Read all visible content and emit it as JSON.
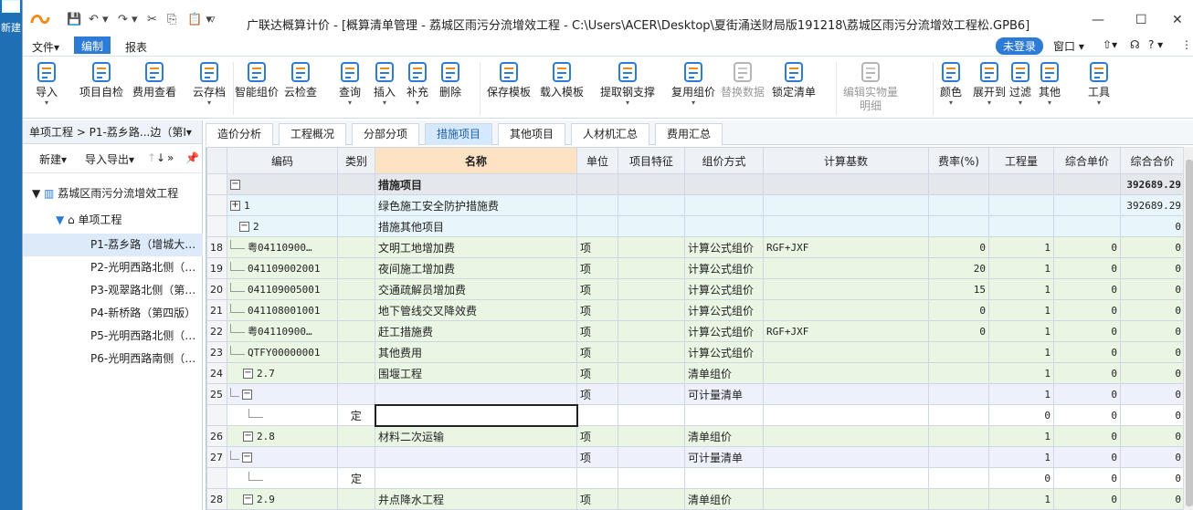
{
  "desktop": {
    "label": "新建"
  },
  "window": {
    "title": "广联达概算计价 - [概算清单管理 - 荔城区雨污分流增效工程 - C:\\Users\\ACER\\Desktop\\夏街涌送财局版191218\\荔城区雨污分流增效工程松.GPB6]",
    "minimize": "—",
    "maximize": "☐",
    "close": "✕"
  },
  "quick_access": [
    "💾",
    "↶ ▾",
    "↷ ▾",
    "✂",
    "⎘",
    "📋 ▾",
    "▿"
  ],
  "menu": {
    "file": "文件▾",
    "edit": "编制",
    "report": "报表",
    "login": "未登录",
    "window": "窗口 ▾",
    "up": "▾",
    "help": "? ▾"
  },
  "ribbon": [
    {
      "label": "导入",
      "icon": "import-icon",
      "drop": true,
      "disabled": false
    },
    {
      "label": "项目自检",
      "icon": "check-icon",
      "drop": false,
      "disabled": false
    },
    {
      "label": "费用查看",
      "icon": "fee-view-icon",
      "drop": false,
      "disabled": false
    },
    {
      "label": "云存档",
      "icon": "cloud-save-icon",
      "drop": true,
      "disabled": false
    },
    {
      "label": "智能组价",
      "icon": "smart-price-icon",
      "drop": false,
      "disabled": false
    },
    {
      "label": "云检查",
      "icon": "cloud-check-icon",
      "drop": false,
      "disabled": false
    },
    {
      "label": "查询",
      "icon": "query-icon",
      "drop": true,
      "disabled": false
    },
    {
      "label": "插入",
      "icon": "insert-icon",
      "drop": true,
      "disabled": false
    },
    {
      "label": "补充",
      "icon": "supplement-icon",
      "drop": true,
      "disabled": false
    },
    {
      "label": "删除",
      "icon": "delete-icon",
      "drop": false,
      "disabled": false
    },
    {
      "label": "保存模板",
      "icon": "save-template-icon",
      "drop": false,
      "disabled": false
    },
    {
      "label": "载入模板",
      "icon": "load-template-icon",
      "drop": false,
      "disabled": false
    },
    {
      "label": "提取钢支撑",
      "icon": "extract-icon",
      "drop": true,
      "disabled": false
    },
    {
      "label": "复用组价",
      "icon": "reuse-icon",
      "drop": true,
      "disabled": false
    },
    {
      "label": "替换数据",
      "icon": "replace-icon",
      "drop": false,
      "disabled": true
    },
    {
      "label": "锁定清单",
      "icon": "lock-icon",
      "drop": false,
      "disabled": false
    },
    {
      "label": "编辑实物量\n明细",
      "icon": "edit-quantity-icon",
      "drop": false,
      "disabled": true
    },
    {
      "label": "颜色",
      "icon": "color-icon",
      "drop": true,
      "disabled": false
    },
    {
      "label": "展开到",
      "icon": "expand-icon",
      "drop": true,
      "disabled": false
    },
    {
      "label": "过滤",
      "icon": "filter-icon",
      "drop": true,
      "disabled": false
    },
    {
      "label": "其他",
      "icon": "other-icon",
      "drop": true,
      "disabled": false
    },
    {
      "label": "工具",
      "icon": "tools-icon",
      "drop": true,
      "disabled": false
    }
  ],
  "left": {
    "breadcrumb": "单项工程 > P1-荔乡路...边（第Ⅰ▾",
    "new_btn": "新建▾",
    "import_export": "导入导出▾",
    "up": "↑",
    "down": "↓",
    "more": "»",
    "pin": "📌",
    "project": "荔城区雨污分流增效工程",
    "unit": "单项工程",
    "items": [
      "P1-荔乡路（增城大…",
      "P2-光明西路北侧（…",
      "P3-观翠路北侧（第…",
      "P4-新桥路（第四版）",
      "P5-光明西路北侧（…",
      "P6-光明西路南侧（…"
    ]
  },
  "tabs": [
    "造价分析",
    "工程概况",
    "分部分项",
    "措施项目",
    "其他项目",
    "人材机汇总",
    "费用汇总"
  ],
  "grid": {
    "headers": [
      "",
      "编码",
      "类别",
      "名称",
      "单位",
      "项目特征",
      "组价方式",
      "计算基数",
      "费率(%)",
      "工程量",
      "综合单价",
      "综合合价"
    ],
    "rows": [
      {
        "cls": "t-gray",
        "rn": "",
        "tree": "box-",
        "code": "",
        "cat": "",
        "name": "措施项目",
        "unit": "",
        "feat": "",
        "method": "",
        "base": "",
        "rate": "",
        "qty": "",
        "price": "",
        "total": "392689.29",
        "bold": true
      },
      {
        "cls": "t-blue",
        "rn": "",
        "tree": "box+",
        "code": "1",
        "cat": "",
        "name": "绿色施工安全防护措施费",
        "unit": "",
        "feat": "",
        "method": "",
        "base": "",
        "rate": "",
        "qty": "",
        "price": "",
        "total": "392689.29"
      },
      {
        "cls": "t-blue",
        "rn": "",
        "tree": "box-",
        "code": "2",
        "cat": "",
        "name": "措施其他项目",
        "unit": "",
        "feat": "",
        "method": "",
        "base": "",
        "rate": "",
        "qty": "",
        "price": "",
        "total": "0"
      },
      {
        "cls": "t-green",
        "rn": "18",
        "tree": "line",
        "code": "粤04110900…",
        "cat": "",
        "name": "文明工地增加费",
        "unit": "项",
        "feat": "",
        "method": "计算公式组价",
        "base": "RGF+JXF",
        "rate": "0",
        "qty": "1",
        "price": "0",
        "total": "0"
      },
      {
        "cls": "t-green",
        "rn": "19",
        "tree": "line",
        "code": "041109002001",
        "cat": "",
        "name": "夜间施工增加费",
        "unit": "项",
        "feat": "",
        "method": "计算公式组价",
        "base": "",
        "rate": "20",
        "qty": "1",
        "price": "0",
        "total": "0"
      },
      {
        "cls": "t-green",
        "rn": "20",
        "tree": "line",
        "code": "041109005001",
        "cat": "",
        "name": "交通疏解员增加费",
        "unit": "项",
        "feat": "",
        "method": "计算公式组价",
        "base": "",
        "rate": "15",
        "qty": "1",
        "price": "0",
        "total": "0"
      },
      {
        "cls": "t-green",
        "rn": "21",
        "tree": "line",
        "code": "041108001001",
        "cat": "",
        "name": "地下管线交叉降效费",
        "unit": "项",
        "feat": "",
        "method": "计算公式组价",
        "base": "",
        "rate": "0",
        "qty": "1",
        "price": "0",
        "total": "0"
      },
      {
        "cls": "t-green",
        "rn": "22",
        "tree": "line",
        "code": "粤04110900…",
        "cat": "",
        "name": "赶工措施费",
        "unit": "项",
        "feat": "",
        "method": "计算公式组价",
        "base": "RGF+JXF",
        "rate": "0",
        "qty": "1",
        "price": "0",
        "total": "0"
      },
      {
        "cls": "t-green",
        "rn": "23",
        "tree": "line",
        "code": "QTFY00000001",
        "cat": "",
        "name": "其他费用",
        "unit": "项",
        "feat": "",
        "method": "计算公式组价",
        "base": "",
        "rate": "",
        "qty": "1",
        "price": "0",
        "total": "0"
      },
      {
        "cls": "t-green",
        "rn": "24",
        "tree": "box-",
        "code": "2.7",
        "cat": "",
        "name": "围堰工程",
        "unit": "项",
        "feat": "",
        "method": "清单组价",
        "base": "",
        "rate": "",
        "qty": "1",
        "price": "0",
        "total": "0"
      },
      {
        "cls": "t-lav",
        "rn": "25",
        "tree": "box-2",
        "code": "",
        "cat": "",
        "name": "",
        "unit": "项",
        "feat": "",
        "method": "可计量清单",
        "base": "",
        "rate": "",
        "qty": "1",
        "price": "0",
        "total": "0"
      },
      {
        "cls": "t-white",
        "rn": "",
        "tree": "line2",
        "code": "",
        "cat": "定",
        "name": "",
        "unit": "",
        "feat": "",
        "method": "",
        "base": "",
        "rate": "",
        "qty": "0",
        "price": "0",
        "total": "0",
        "editing": true
      },
      {
        "cls": "t-green",
        "rn": "26",
        "tree": "box-",
        "code": "2.8",
        "cat": "",
        "name": "材料二次运输",
        "unit": "项",
        "feat": "",
        "method": "清单组价",
        "base": "",
        "rate": "",
        "qty": "1",
        "price": "0",
        "total": "0"
      },
      {
        "cls": "t-lav",
        "rn": "27",
        "tree": "box-2",
        "code": "",
        "cat": "",
        "name": "",
        "unit": "项",
        "feat": "",
        "method": "可计量清单",
        "base": "",
        "rate": "",
        "qty": "1",
        "price": "0",
        "total": "0"
      },
      {
        "cls": "t-white",
        "rn": "",
        "tree": "line2",
        "code": "",
        "cat": "定",
        "name": "",
        "unit": "",
        "feat": "",
        "method": "",
        "base": "",
        "rate": "",
        "qty": "0",
        "price": "0",
        "total": "0"
      },
      {
        "cls": "t-green",
        "rn": "28",
        "tree": "box-",
        "code": "2.9",
        "cat": "",
        "name": "井点降水工程",
        "unit": "项",
        "feat": "",
        "method": "清单组价",
        "base": "",
        "rate": "",
        "qty": "1",
        "price": "0",
        "total": "0"
      }
    ]
  },
  "colors": {
    "accent": "#2c7bd6",
    "orange": "#f08c1a",
    "header_name": "#fde2c3"
  }
}
